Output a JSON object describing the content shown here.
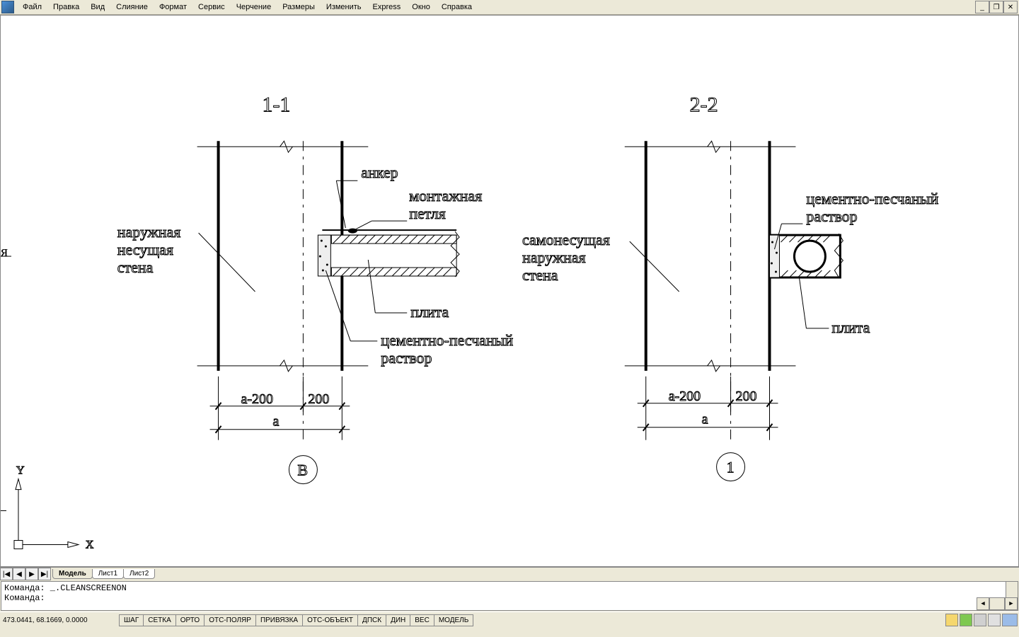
{
  "menu": {
    "items": [
      "Файл",
      "Правка",
      "Вид",
      "Слияние",
      "Формат",
      "Сервис",
      "Черчение",
      "Размеры",
      "Изменить",
      "Express",
      "Окно",
      "Справка"
    ]
  },
  "win_controls": {
    "min": "_",
    "restore": "❐",
    "close": "✕"
  },
  "canvas": {
    "axis_y": "Y",
    "axis_x": "X",
    "section1": {
      "title": "1-1",
      "labels": {
        "anchor": "анкер",
        "loop1": "монтажная",
        "loop2": "петля",
        "wall1": "наружная",
        "wall2": "несущая",
        "wall3": "стена",
        "slab": "плита",
        "mortar1": "цементно-песчаный",
        "mortar2": "раствор"
      },
      "dims": {
        "left": "а-200",
        "right": "200",
        "total": "а",
        "marker": "В"
      },
      "cut_text": "я"
    },
    "section2": {
      "title": "2-2",
      "labels": {
        "wall1": "самонесущая",
        "wall2": "наружная",
        "wall3": "стена",
        "slab": "плита",
        "mortar1": "цементно-песчаный",
        "mortar2": "раствор"
      },
      "dims": {
        "left": "а-200",
        "right": "200",
        "total": "а",
        "marker": "1"
      }
    }
  },
  "tabs": {
    "nav": [
      "|◀",
      "◀",
      "▶",
      "▶|"
    ],
    "items": [
      "Модель",
      "Лист1",
      "Лист2"
    ],
    "active": 0
  },
  "command": {
    "line1": "Команда: _.CLEANSCREENON",
    "line2": "Команда:"
  },
  "status": {
    "coords": "473.0441, 68.1669, 0.0000",
    "toggles": [
      "ШАГ",
      "СЕТКА",
      "ОРТО",
      "ОТС-ПОЛЯР",
      "ПРИВЯЗКА",
      "ОТС-ОБЪЕКТ",
      "ДПСК",
      "ДИН",
      "ВЕС",
      "МОДЕЛЬ"
    ]
  }
}
